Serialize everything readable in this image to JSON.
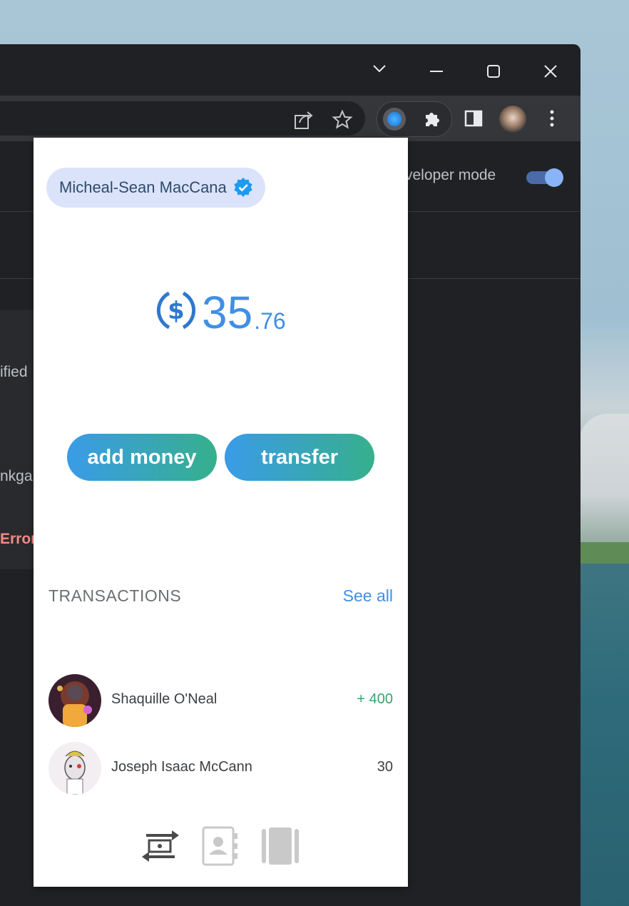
{
  "browser": {
    "developer_mode_label": "veloper mode",
    "left_fragments": {
      "frag_1": "ified",
      "frag_2": "nkga",
      "frag_3": "Error"
    }
  },
  "popup": {
    "user_name": "Micheal-Sean MacCana",
    "balance_integer": "35",
    "balance_decimal": ".76",
    "add_money_label": "add money",
    "transfer_label": "transfer",
    "transactions_title": "TRANSACTIONS",
    "see_all_label": "See all",
    "transactions": [
      {
        "name": "Shaquille O'Neal",
        "amount": "+ 400",
        "amount_color": "#35a56c"
      },
      {
        "name": "Joseph Isaac McCann",
        "amount": "30",
        "amount_color": "#3c3f43"
      }
    ]
  },
  "colors": {
    "accent_blue": "#3f8fe6",
    "accent_green": "#36b08c",
    "pill_bg": "#dbe3fb"
  },
  "icons": {
    "nav": [
      "transfer-icon",
      "contacts-icon",
      "cards-icon"
    ]
  }
}
